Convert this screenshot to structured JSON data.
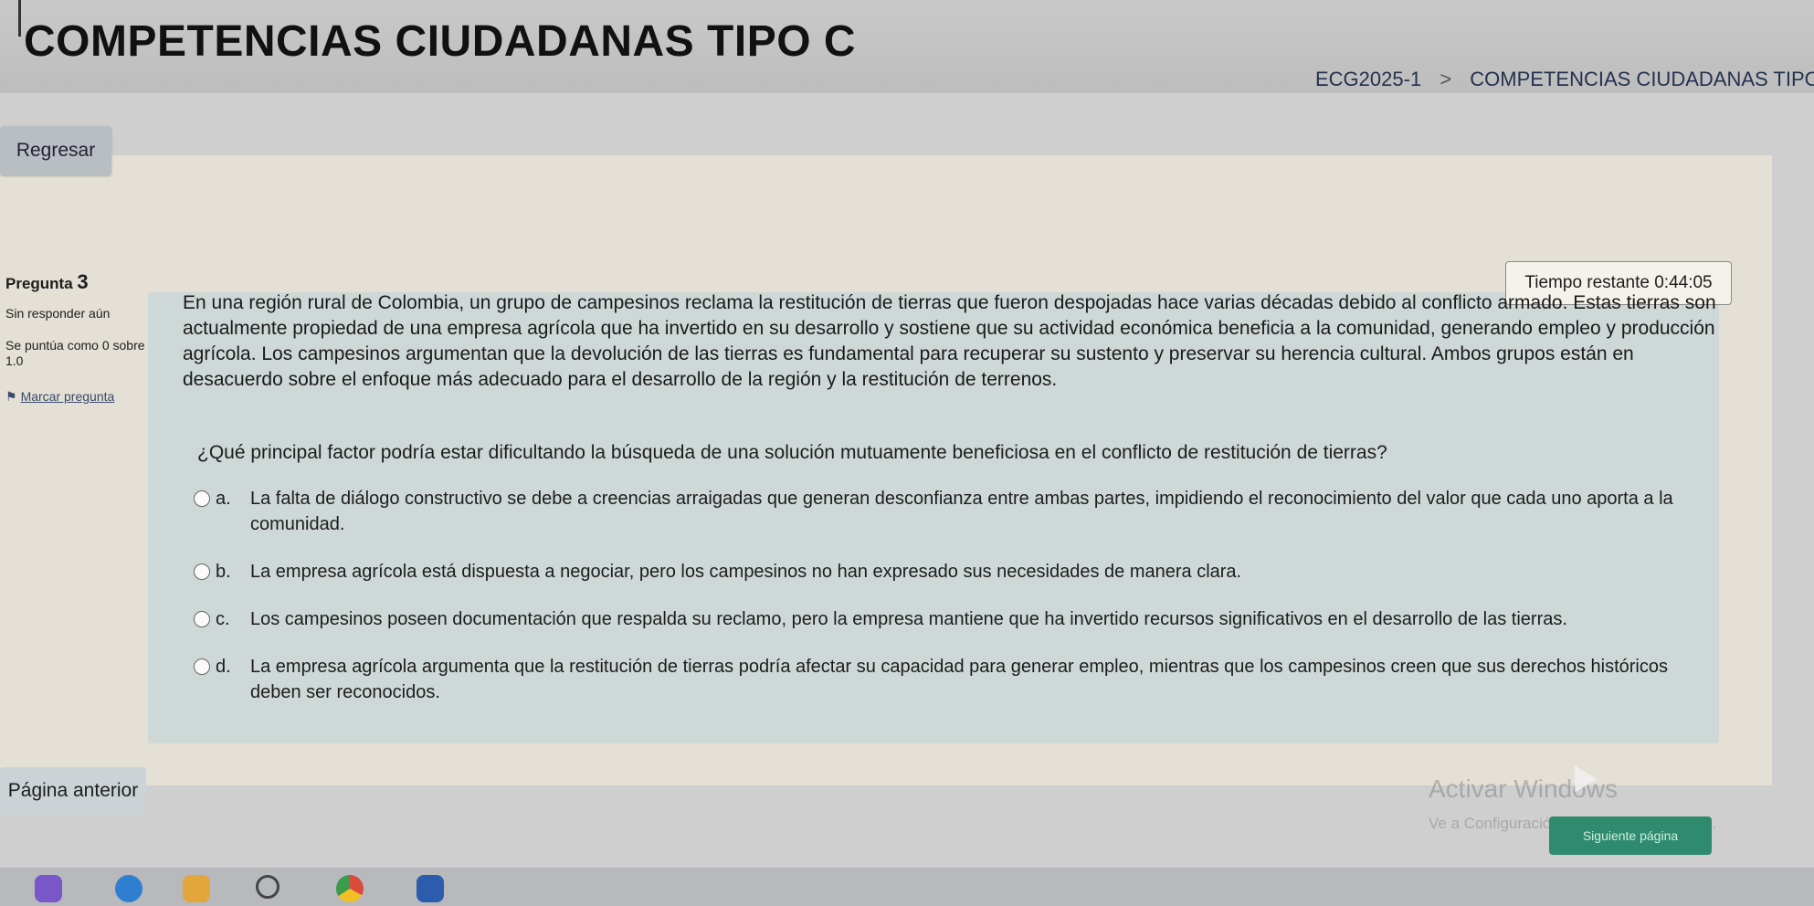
{
  "header": {
    "title": "COMPETENCIAS CIUDADANAS TIPO C",
    "breadcrumb": [
      "ECG2025-1",
      "COMPETENCIAS CIUDADANAS TIPO C"
    ],
    "breadcrumb_separator": ">"
  },
  "nav": {
    "back_label": "Regresar"
  },
  "question_info": {
    "label": "Pregunta",
    "number": "3",
    "status": "Sin responder aún",
    "grade": "Se puntúa como 0 sobre 1.0",
    "flag_label": "Marcar pregunta"
  },
  "timer": {
    "text": "Tiempo restante 0:44:05"
  },
  "question": {
    "text": "En una región rural de Colombia, un grupo de campesinos reclama la restitución de tierras que fueron despojadas hace varias décadas debido al conflicto armado. Estas tierras son actualmente propiedad de una empresa agrícola que ha invertido en su desarrollo y sostiene que su actividad económica beneficia a la comunidad, generando empleo y producción agrícola. Los campesinos argumentan que la devolución de las tierras es fundamental para recuperar su sustento y preservar su herencia cultural. Ambos grupos están en desacuerdo sobre el enfoque más adecuado para el desarrollo de la región y la restitución de terrenos.",
    "prompt": "¿Qué principal factor podría estar dificultando la búsqueda de una solución mutuamente beneficiosa en el conflicto de restitución de tierras?",
    "options": [
      {
        "letter": "a.",
        "text": "La falta de diálogo constructivo se debe a creencias arraigadas que generan desconfianza entre ambas partes, impidiendo el reconocimiento del valor que cada uno aporta a la comunidad."
      },
      {
        "letter": "b.",
        "text": "La empresa agrícola está dispuesta a negociar, pero los campesinos no han expresado sus necesidades de manera clara."
      },
      {
        "letter": "c.",
        "text": "Los campesinos poseen documentación que respalda su reclamo, pero la empresa mantiene que ha invertido recursos significativos en el desarrollo de las tierras."
      },
      {
        "letter": "d.",
        "text": "La empresa agrícola argumenta que la restitución de tierras podría afectar su capacidad para generar empleo, mientras que los campesinos creen que sus derechos históricos deben ser reconocidos."
      }
    ]
  },
  "footer": {
    "prev_label": "Página anterior",
    "next_label": "Siguiente página"
  },
  "watermark": {
    "title": "Activar Windows",
    "subtitle": "Ve a Configuración para activar Windows."
  },
  "taskbar_icons": [
    "game-icon",
    "edge-browser-icon",
    "file-explorer-icon",
    "search-icon",
    "chrome-icon",
    "word-icon"
  ]
}
